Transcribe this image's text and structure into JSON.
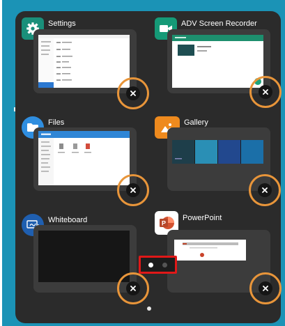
{
  "colors": {
    "frame": "#1b93b6",
    "panel": "#2b2b2b",
    "card": "#3c3c3c",
    "highlight_ring": "#e8953a",
    "pager_highlight": "#e01818",
    "settings_icon_bg": "#1a8f7a",
    "recorder_icon_bg": "#159a77",
    "files_icon_bg": "#2f8ee0",
    "gallery_icon_bg": "#ee8a1e",
    "whiteboard_icon_bg": "#1f5fb0",
    "powerpoint_icon_bg": "#c9432a"
  },
  "apps": [
    {
      "id": "settings",
      "title": "Settings",
      "icon": "gear-icon"
    },
    {
      "id": "adv-screen-recorder",
      "title": "ADV Screen Recorder",
      "icon": "video-camera-icon"
    },
    {
      "id": "files",
      "title": "Files",
      "icon": "folder-icon"
    },
    {
      "id": "gallery",
      "title": "Gallery",
      "icon": "image-icon"
    },
    {
      "id": "whiteboard",
      "title": "Whiteboard",
      "icon": "whiteboard-pen-icon"
    },
    {
      "id": "powerpoint",
      "title": "PowerPoint",
      "icon": "powerpoint-icon"
    }
  ],
  "pager": {
    "pages": 2,
    "current": 1
  }
}
